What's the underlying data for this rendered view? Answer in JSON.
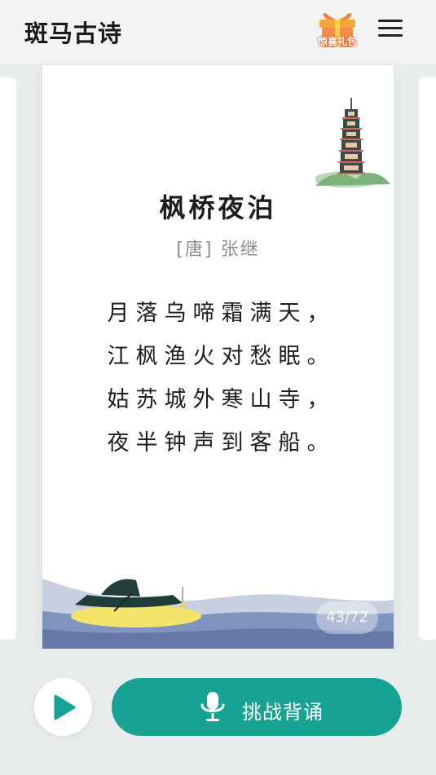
{
  "header": {
    "app_title": "斑马古诗",
    "gift_label": "惊喜礼包"
  },
  "poem": {
    "title": "枫桥夜泊",
    "author": "[唐] 张继",
    "lines": [
      "月落乌啼霜满天，",
      "江枫渔火对愁眠。",
      "姑苏城外寒山寺，",
      "夜半钟声到客船。"
    ],
    "page_counter": "43/72"
  },
  "actions": {
    "recite_label": "挑战背诵"
  },
  "icons": {
    "gift": "gift-icon",
    "menu": "menu-icon",
    "play": "play-icon",
    "mic": "microphone-icon"
  },
  "colors": {
    "accent": "#16a394",
    "background": "#e9ecec",
    "gift_orange": "#f4813f"
  }
}
